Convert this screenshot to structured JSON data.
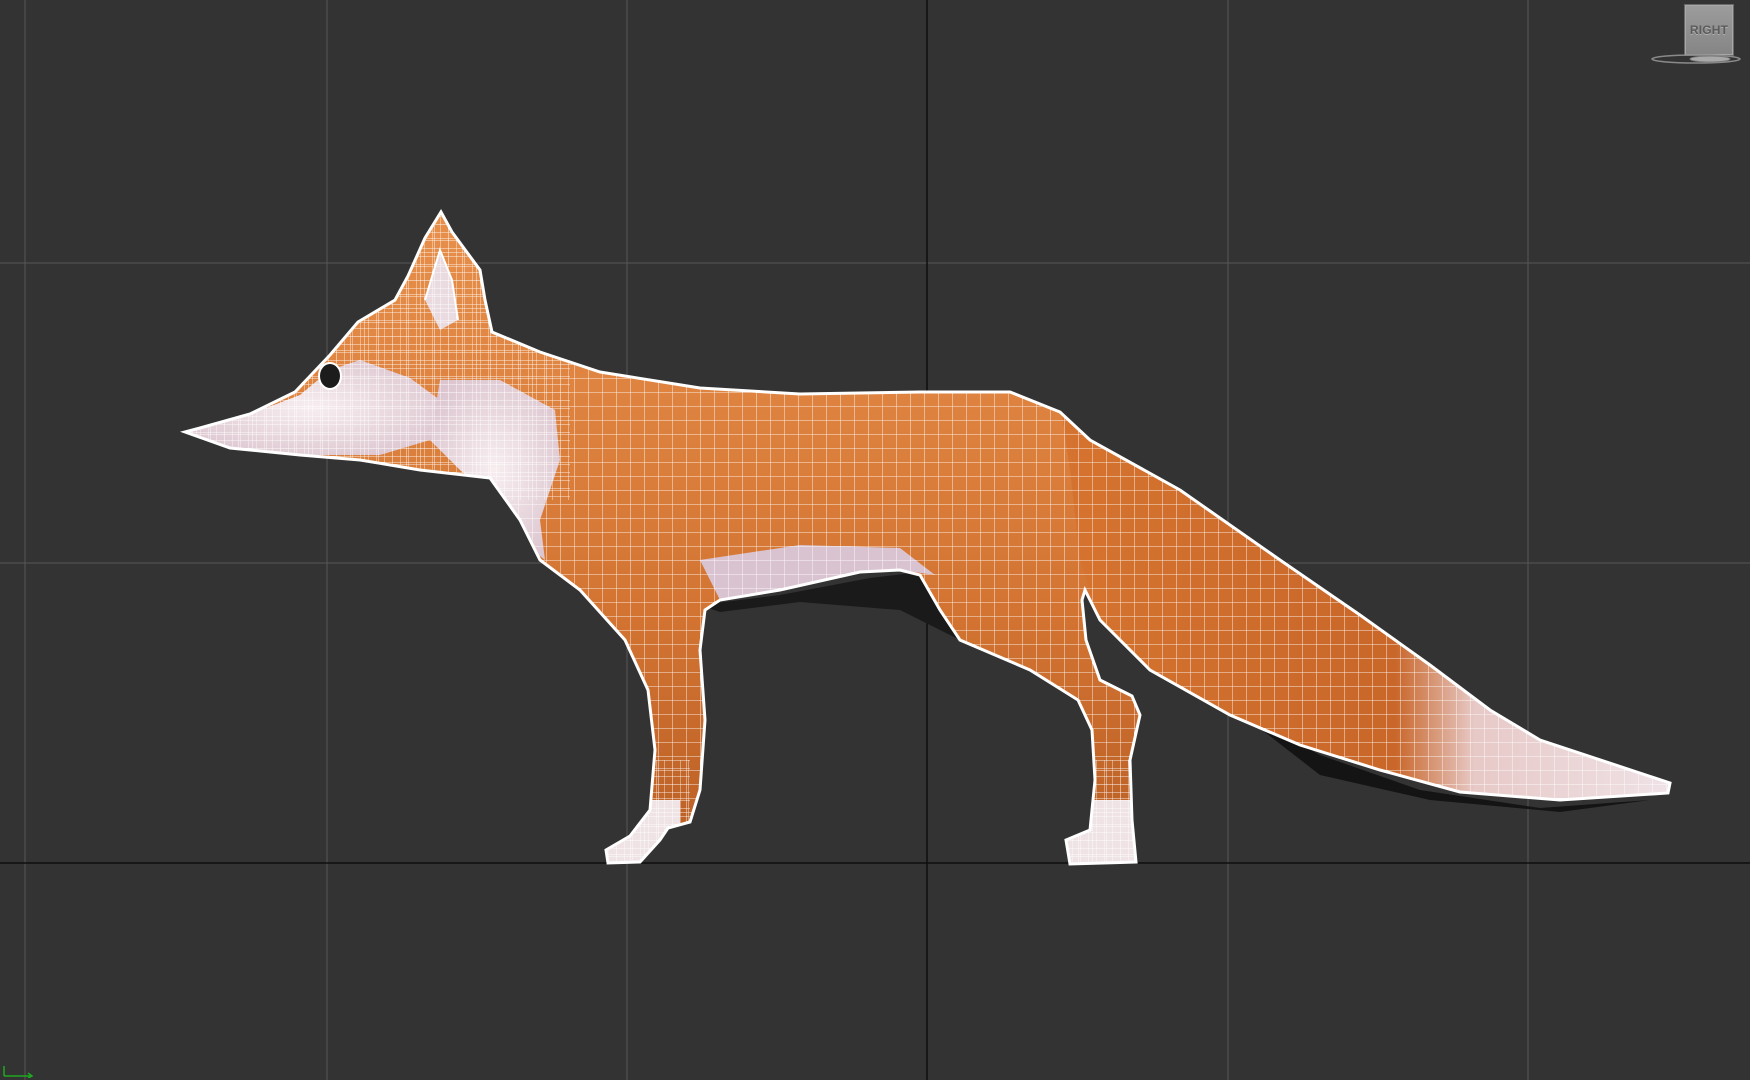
{
  "viewport": {
    "name": "Right",
    "background_color": "#333333",
    "grid_line_color": "#5a5a5a",
    "axis_line_color": "#0e0e0e",
    "wireframe_color": "#ffffff",
    "shading_colors": [
      "#e08a4a",
      "#c9692c",
      "#f0e4e6",
      "#d9c3d0"
    ]
  },
  "viewcube": {
    "label": "RIGHT",
    "icon": "viewcube-icon"
  },
  "axis_tripod": {
    "icon": "axis-tripod-icon",
    "color": "#1fa81f"
  },
  "model": {
    "icon": "fox-mesh"
  }
}
